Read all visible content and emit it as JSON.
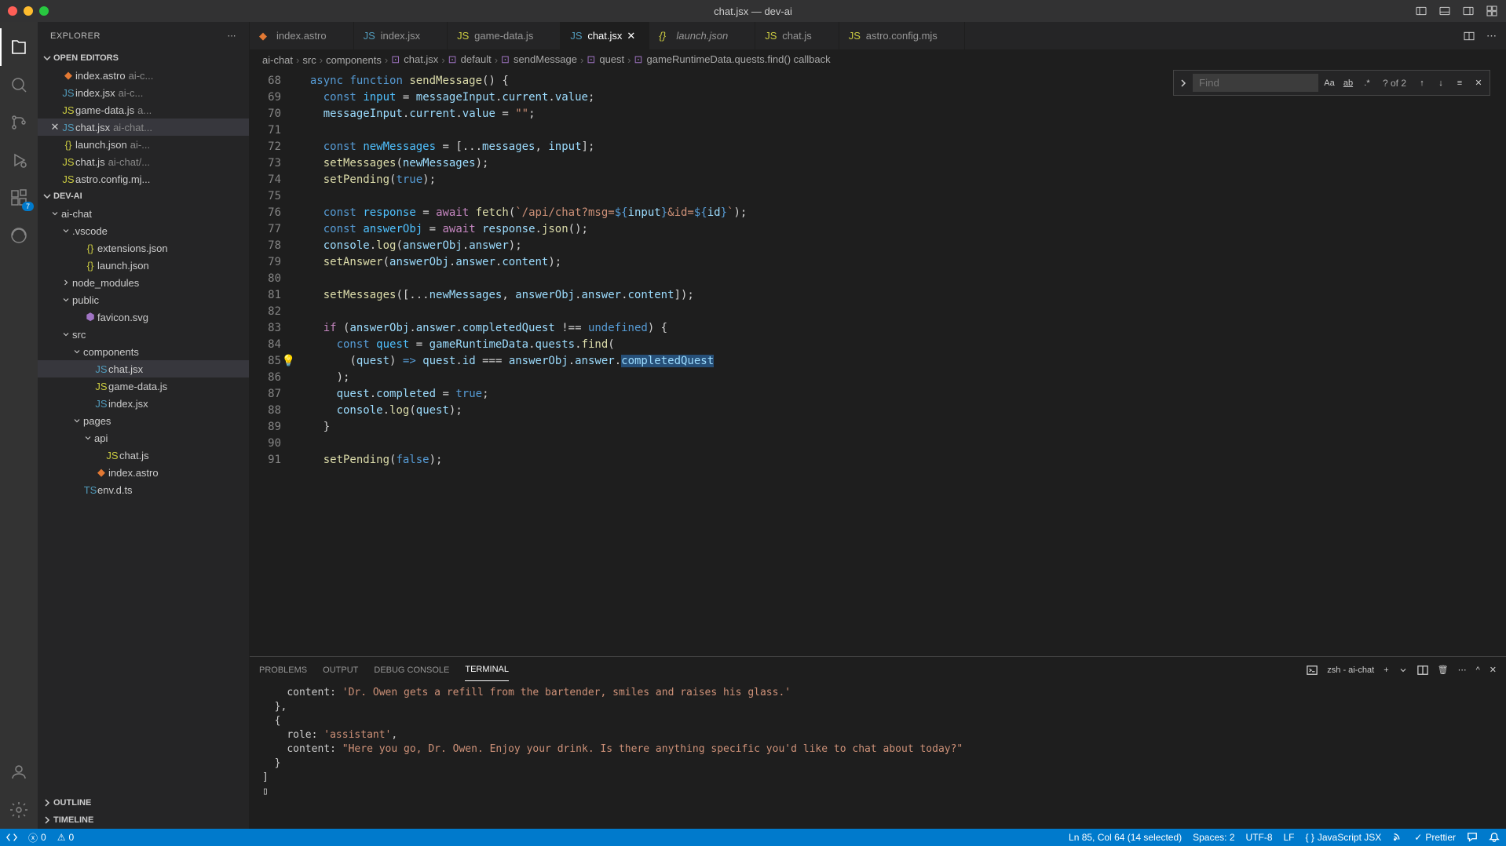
{
  "window": {
    "title": "chat.jsx — dev-ai"
  },
  "sidebar": {
    "title": "EXPLORER",
    "sections": {
      "open_editors": "OPEN EDITORS",
      "root": "DEV-AI",
      "outline": "OUTLINE",
      "timeline": "TIMELINE"
    },
    "open_editors": [
      {
        "name": "index.astro",
        "desc": "ai-c..."
      },
      {
        "name": "index.jsx",
        "desc": "ai-c..."
      },
      {
        "name": "game-data.js",
        "desc": "a..."
      },
      {
        "name": "chat.jsx",
        "desc": "ai-chat..."
      },
      {
        "name": "launch.json",
        "desc": "ai-..."
      },
      {
        "name": "chat.js",
        "desc": "ai-chat/..."
      },
      {
        "name": "astro.config.mj...",
        "desc": ""
      }
    ],
    "tree": [
      {
        "label": "ai-chat",
        "depth": 0,
        "folder": true
      },
      {
        "label": ".vscode",
        "depth": 1,
        "folder": true
      },
      {
        "label": "extensions.json",
        "depth": 2,
        "icon": "{}"
      },
      {
        "label": "launch.json",
        "depth": 2,
        "icon": "{}"
      },
      {
        "label": "node_modules",
        "depth": 1,
        "folder": true,
        "collapsed": true
      },
      {
        "label": "public",
        "depth": 1,
        "folder": true
      },
      {
        "label": "favicon.svg",
        "depth": 2,
        "icon": "svg"
      },
      {
        "label": "src",
        "depth": 1,
        "folder": true
      },
      {
        "label": "components",
        "depth": 2,
        "folder": true
      },
      {
        "label": "chat.jsx",
        "depth": 3,
        "icon": "jsx",
        "active": true
      },
      {
        "label": "game-data.js",
        "depth": 3,
        "icon": "js"
      },
      {
        "label": "index.jsx",
        "depth": 3,
        "icon": "jsx"
      },
      {
        "label": "pages",
        "depth": 2,
        "folder": true
      },
      {
        "label": "api",
        "depth": 3,
        "folder": true
      },
      {
        "label": "chat.js",
        "depth": 4,
        "icon": "js"
      },
      {
        "label": "index.astro",
        "depth": 3,
        "icon": "astro"
      },
      {
        "label": "env.d.ts",
        "depth": 2,
        "icon": "ts"
      }
    ]
  },
  "activity_badge": "7",
  "tabs": [
    {
      "label": "index.astro",
      "icon": "astro"
    },
    {
      "label": "index.jsx",
      "icon": "jsx"
    },
    {
      "label": "game-data.js",
      "icon": "js"
    },
    {
      "label": "chat.jsx",
      "icon": "jsx",
      "active": true
    },
    {
      "label": "launch.json",
      "icon": "{}",
      "italic": true
    },
    {
      "label": "chat.js",
      "icon": "js"
    },
    {
      "label": "astro.config.mjs",
      "icon": "js"
    }
  ],
  "breadcrumb": [
    "ai-chat",
    "src",
    "components",
    "chat.jsx",
    "default",
    "sendMessage",
    "quest",
    "gameRuntimeData.quests.find() callback"
  ],
  "find": {
    "placeholder": "Find",
    "results": "? of 2"
  },
  "code_lines": [
    {
      "n": 68,
      "html": "  <span class='kw'>async</span> <span class='kw'>function</span> <span class='fn'>sendMessage</span><span class='pn'>() {</span>"
    },
    {
      "n": 69,
      "html": "    <span class='kw'>const</span> <span class='const2'>input</span> <span class='pn'>=</span> <span class='var'>messageInput</span><span class='pn'>.</span><span class='prop'>current</span><span class='pn'>.</span><span class='prop'>value</span><span class='pn'>;</span>"
    },
    {
      "n": 70,
      "html": "    <span class='var'>messageInput</span><span class='pn'>.</span><span class='prop'>current</span><span class='pn'>.</span><span class='prop'>value</span> <span class='pn'>=</span> <span class='str'>\"\"</span><span class='pn'>;</span>"
    },
    {
      "n": 71,
      "html": ""
    },
    {
      "n": 72,
      "html": "    <span class='kw'>const</span> <span class='const2'>newMessages</span> <span class='pn'>= [...</span><span class='var'>messages</span><span class='pn'>,</span> <span class='var'>input</span><span class='pn'>];</span>"
    },
    {
      "n": 73,
      "html": "    <span class='fn'>setMessages</span><span class='pn'>(</span><span class='var'>newMessages</span><span class='pn'>);</span>"
    },
    {
      "n": 74,
      "html": "    <span class='fn'>setPending</span><span class='pn'>(</span><span class='kw'>true</span><span class='pn'>);</span>"
    },
    {
      "n": 75,
      "html": ""
    },
    {
      "n": 76,
      "html": "    <span class='kw'>const</span> <span class='const2'>response</span> <span class='pn'>=</span> <span class='kw2'>await</span> <span class='fn'>fetch</span><span class='pn'>(</span><span class='str'>`/api/chat?msg=<span class='kw'>${</span><span class='var'>input</span><span class='kw'>}</span>&id=<span class='kw'>${</span><span class='var'>id</span><span class='kw'>}</span>`</span><span class='pn'>);</span>"
    },
    {
      "n": 77,
      "html": "    <span class='kw'>const</span> <span class='const2'>answerObj</span> <span class='pn'>=</span> <span class='kw2'>await</span> <span class='var'>response</span><span class='pn'>.</span><span class='fn'>json</span><span class='pn'>();</span>"
    },
    {
      "n": 78,
      "html": "    <span class='var'>console</span><span class='pn'>.</span><span class='fn'>log</span><span class='pn'>(</span><span class='var'>answerObj</span><span class='pn'>.</span><span class='prop'>answer</span><span class='pn'>);</span>"
    },
    {
      "n": 79,
      "html": "    <span class='fn'>setAnswer</span><span class='pn'>(</span><span class='var'>answerObj</span><span class='pn'>.</span><span class='prop'>answer</span><span class='pn'>.</span><span class='prop'>content</span><span class='pn'>);</span>"
    },
    {
      "n": 80,
      "html": ""
    },
    {
      "n": 81,
      "html": "    <span class='fn'>setMessages</span><span class='pn'>([...</span><span class='var'>newMessages</span><span class='pn'>,</span> <span class='var'>answerObj</span><span class='pn'>.</span><span class='prop'>answer</span><span class='pn'>.</span><span class='prop'>content</span><span class='pn'>]);</span>"
    },
    {
      "n": 82,
      "html": ""
    },
    {
      "n": 83,
      "html": "    <span class='kw2'>if</span> <span class='pn'>(</span><span class='var'>answerObj</span><span class='pn'>.</span><span class='prop'>answer</span><span class='pn'>.</span><span class='prop'>completedQuest</span> <span class='pn'>!==</span> <span class='kw'>undefined</span><span class='pn'>) {</span>"
    },
    {
      "n": 84,
      "html": "      <span class='kw'>const</span> <span class='const2'>quest</span> <span class='pn'>=</span> <span class='var'>gameRuntimeData</span><span class='pn'>.</span><span class='prop'>quests</span><span class='pn'>.</span><span class='fn'>find</span><span class='pn'>(</span>"
    },
    {
      "n": 85,
      "html": "        <span class='pn'>(</span><span class='var'>quest</span><span class='pn'>)</span> <span class='kw'>=></span> <span class='var'>quest</span><span class='pn'>.</span><span class='prop'>id</span> <span class='pn'>===</span> <span class='var'>answerObj</span><span class='pn'>.</span><span class='prop'>answer</span><span class='pn'>.</span><span class='hl'><span class='prop'>completedQuest</span></span>",
      "bulb": true
    },
    {
      "n": 86,
      "html": "      <span class='pn'>);</span>"
    },
    {
      "n": 87,
      "html": "      <span class='var'>quest</span><span class='pn'>.</span><span class='prop'>completed</span> <span class='pn'>=</span> <span class='kw'>true</span><span class='pn'>;</span>"
    },
    {
      "n": 88,
      "html": "      <span class='var'>console</span><span class='pn'>.</span><span class='fn'>log</span><span class='pn'>(</span><span class='var'>quest</span><span class='pn'>);</span>"
    },
    {
      "n": 89,
      "html": "    <span class='pn'>}</span>"
    },
    {
      "n": 90,
      "html": ""
    },
    {
      "n": 91,
      "html": "    <span class='fn'>setPending</span><span class='pn'>(</span><span class='kw'>false</span><span class='pn'>);</span>"
    }
  ],
  "panel": {
    "tabs": [
      "PROBLEMS",
      "OUTPUT",
      "DEBUG CONSOLE",
      "TERMINAL"
    ],
    "active": 3,
    "terminal_label": "zsh - ai-chat",
    "terminal_lines": [
      "    content: <span class='s'>'Dr. Owen gets a refill from the bartender, smiles and raises his glass.'</span>",
      "  },",
      "  {",
      "    role: <span class='s'>'assistant'</span>,",
      "    content: <span class='s'>\"Here you go, Dr. Owen. Enjoy your drink. Is there anything specific you'd like to chat about today?\"</span>",
      "  }",
      "]",
      "▯"
    ]
  },
  "status": {
    "errors": "0",
    "warnings": "0",
    "cursor": "Ln 85, Col 64 (14 selected)",
    "spaces": "Spaces: 2",
    "encoding": "UTF-8",
    "eol": "LF",
    "lang": "JavaScript JSX",
    "prettier": "Prettier"
  }
}
